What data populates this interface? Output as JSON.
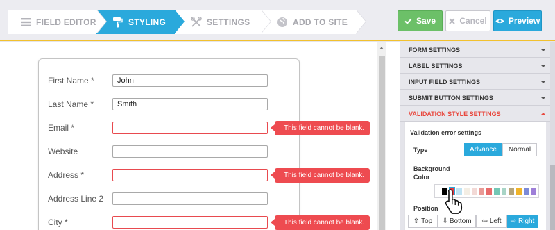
{
  "steps": [
    {
      "label": "FIELD EDITOR",
      "icon": "menu-lines-icon",
      "active": false
    },
    {
      "label": "STYLING",
      "icon": "paint-roller-icon",
      "active": true
    },
    {
      "label": "SETTINGS",
      "icon": "tools-icon",
      "active": false
    },
    {
      "label": "ADD TO SITE",
      "icon": "globe-icon",
      "active": false
    }
  ],
  "toolbar": {
    "save_label": "Save",
    "cancel_label": "Cancel",
    "preview_label": "Preview"
  },
  "form": {
    "fields": [
      {
        "label": "First Name *",
        "value": "John",
        "error": false
      },
      {
        "label": "Last Name *",
        "value": "Smith",
        "error": false
      },
      {
        "label": "Email *",
        "value": "",
        "error": true
      },
      {
        "label": "Website",
        "value": "",
        "error": false
      },
      {
        "label": "Address *",
        "value": "",
        "error": true
      },
      {
        "label": "Address Line 2",
        "value": "",
        "error": false
      },
      {
        "label": "City *",
        "value": "",
        "error": true
      }
    ],
    "error_message": "This field cannot be blank."
  },
  "settings_panel": {
    "sections": [
      {
        "label": "FORM SETTINGS",
        "open": false
      },
      {
        "label": "LABEL SETTINGS",
        "open": false
      },
      {
        "label": "INPUT FIELD SETTINGS",
        "open": false
      },
      {
        "label": "SUBMIT BUTTON SETTINGS",
        "open": false
      },
      {
        "label": "VALIDATION STYLE SETTINGS",
        "open": true
      }
    ],
    "validation": {
      "title": "Validation error settings",
      "type_label": "Type",
      "type_options": [
        "Advance",
        "Normal"
      ],
      "type_selected": "Advance",
      "bg_label_line1": "Background",
      "bg_label_line2": "Color",
      "swatches": [
        "#000000",
        "#e8393f",
        "#bfe3f3",
        "#f4eee4",
        "#f2d9d6",
        "#e99a96",
        "#e86b6b",
        "#74c7b5",
        "#a8d4c6",
        "#b5a57a",
        "#f0b42a",
        "#7c8ad8",
        "#9e7fd8"
      ],
      "swatch_selected_index": 1,
      "position_label": "Position",
      "position_options": [
        "Top",
        "Bottom",
        "Left",
        "Right"
      ],
      "position_selected": "Right"
    }
  },
  "colors": {
    "accent": "#2aa9dc",
    "save_green": "#6cc068",
    "error_red": "#ee4b50",
    "divider_yellow": "#f2c12e"
  }
}
